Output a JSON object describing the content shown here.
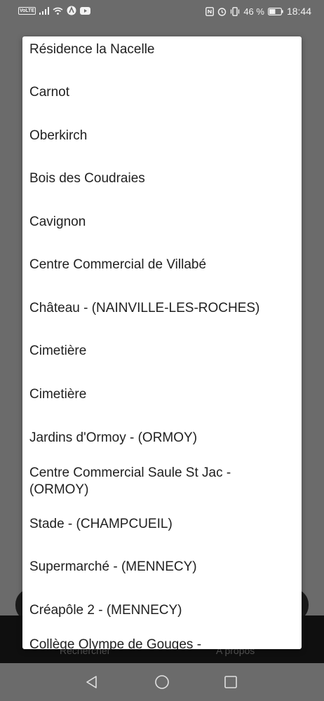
{
  "status_bar": {
    "network_badge": "VoLTE",
    "battery_percent": "46 %",
    "time": "18:44",
    "icons": [
      "signal-icon",
      "wifi-icon",
      "navigation-icon",
      "youtube-icon",
      "nfc-icon",
      "alarm-icon",
      "vibrate-icon",
      "battery-icon"
    ]
  },
  "stop_list": {
    "items": [
      {
        "label": "Résidence la Nacelle"
      },
      {
        "label": "Carnot"
      },
      {
        "label": "Oberkirch"
      },
      {
        "label": "Bois des Coudraies"
      },
      {
        "label": "Cavignon"
      },
      {
        "label": "Centre Commercial de Villabé"
      },
      {
        "label": "Château - (NAINVILLE-LES-ROCHES)"
      },
      {
        "label": "Cimetière"
      },
      {
        "label": "Cimetière"
      },
      {
        "label": "Jardins d'Ormoy - (ORMOY)"
      },
      {
        "label": "Centre Commercial Saule St Jac - (ORMOY)"
      },
      {
        "label": "Stade - (CHAMPCUEIL)"
      },
      {
        "label": "Supermarché - (MENNECY)"
      },
      {
        "label": "Créapôle 2 - (MENNECY)"
      },
      {
        "label": "Collège Olympe de Gouges -"
      }
    ]
  },
  "bottom_tabs": {
    "search_label": "Rechercher",
    "about_label": "A propos"
  },
  "colors": {
    "scrim": "#6b6b6b",
    "dialog_bg": "#ffffff",
    "text": "#212121"
  }
}
